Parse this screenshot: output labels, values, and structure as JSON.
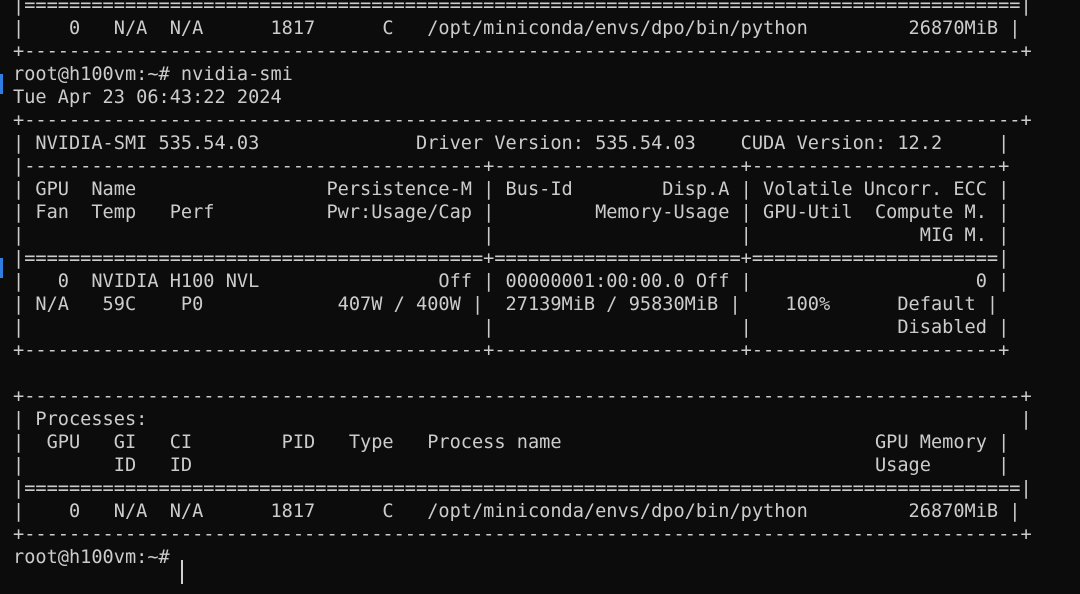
{
  "terminal": {
    "lines": [
      "|=========================================================================================|",
      "|    0   N/A  N/A      1817      C   /opt/miniconda/envs/dpo/bin/python         26870MiB |",
      "+-----------------------------------------------------------------------------------------+",
      "root@h100vm:~# nvidia-smi",
      "Tue Apr 23 06:43:22 2024",
      "+-----------------------------------------------------------------------------------------+",
      "| NVIDIA-SMI 535.54.03              Driver Version: 535.54.03    CUDA Version: 12.2     |",
      "|-----------------------------------------+----------------------+----------------------+",
      "| GPU  Name                 Persistence-M | Bus-Id        Disp.A | Volatile Uncorr. ECC |",
      "| Fan  Temp   Perf          Pwr:Usage/Cap |         Memory-Usage | GPU-Util  Compute M. |",
      "|                                         |                      |               MIG M. |",
      "|=========================================+======================+======================|",
      "|   0  NVIDIA H100 NVL                Off | 00000001:00:00.0 Off |                    0 |",
      "| N/A   59C    P0            407W / 400W |  27139MiB / 95830MiB |    100%      Default |",
      "|                                         |                      |             Disabled |",
      "+-----------------------------------------+----------------------+----------------------+",
      "",
      "+-----------------------------------------------------------------------------------------+",
      "| Processes:                                                                              |",
      "|  GPU   GI   CI        PID   Type   Process name                            GPU Memory |",
      "|        ID   ID                                                             Usage      |",
      "|=========================================================================================|",
      "|    0   N/A  N/A      1817      C   /opt/miniconda/envs/dpo/bin/python         26870MiB |",
      "+-----------------------------------------------------------------------------------------+",
      "root@h100vm:~# "
    ]
  }
}
